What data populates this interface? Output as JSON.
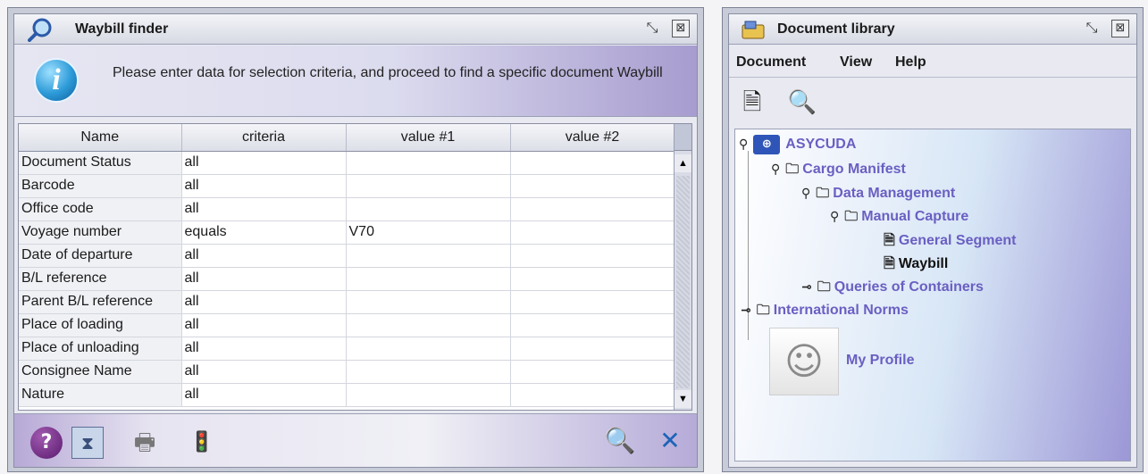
{
  "finder": {
    "title": "Waybill finder",
    "icons": {
      "title": "magnifier-icon",
      "restore": "restore-icon",
      "maximize": "maximize-icon",
      "info": "info-icon"
    },
    "info_letter": "i",
    "info_text": "Please enter data for selection criteria, and proceed to find a specific document Waybill",
    "table": {
      "columns": [
        "Name",
        "criteria",
        "value #1",
        "value #2"
      ],
      "rows": [
        [
          "Document Status",
          "all",
          "",
          ""
        ],
        [
          "Barcode",
          "all",
          "",
          ""
        ],
        [
          "Office code",
          "all",
          "",
          ""
        ],
        [
          "Voyage number",
          "equals",
          "V70",
          ""
        ],
        [
          "Date of departure",
          "all",
          "",
          ""
        ],
        [
          "B/L reference",
          "all",
          "",
          ""
        ],
        [
          "Parent B/L reference",
          "all",
          "",
          ""
        ],
        [
          "Place of loading",
          "all",
          "",
          ""
        ],
        [
          "Place of unloading",
          "all",
          "",
          ""
        ],
        [
          "Consignee Name",
          "all",
          "",
          ""
        ],
        [
          "Nature",
          "all",
          "",
          ""
        ]
      ]
    },
    "footer": {
      "help_glyph": "?",
      "hourglass_glyph": "⧗",
      "printer_glyph": "🖶",
      "traffic_glyph": "🚦",
      "find_glyph": "🔍",
      "close_glyph": "✕",
      "icons": [
        "help-icon",
        "hourglass-icon",
        "printer-icon",
        "traffic-light-icon",
        "find-icon",
        "close-icon"
      ]
    },
    "colors": {
      "accent": "#a79ccf",
      "info_blue": "#2c9ad8",
      "close_blue": "#1e63b8"
    }
  },
  "library": {
    "title": "Document library",
    "menu": [
      "Document",
      "View",
      "Help"
    ],
    "toolbar": {
      "new_doc_glyph": "🗎",
      "search_glyph": "🔍"
    },
    "tree": {
      "root": {
        "label": "ASYCUDA",
        "flag_glyph": "⊕"
      },
      "cargo_manifest": "Cargo Manifest",
      "data_management": "Data Management",
      "manual_capture": "Manual Capture",
      "general_segment": "General Segment",
      "waybill": "Waybill",
      "queries_of_containers": "Queries of Containers",
      "international_norms": "International Norms",
      "my_profile": "My Profile"
    },
    "colors": {
      "tree_text": "#6a5fc2",
      "flag_blue": "#2f55b8"
    }
  }
}
